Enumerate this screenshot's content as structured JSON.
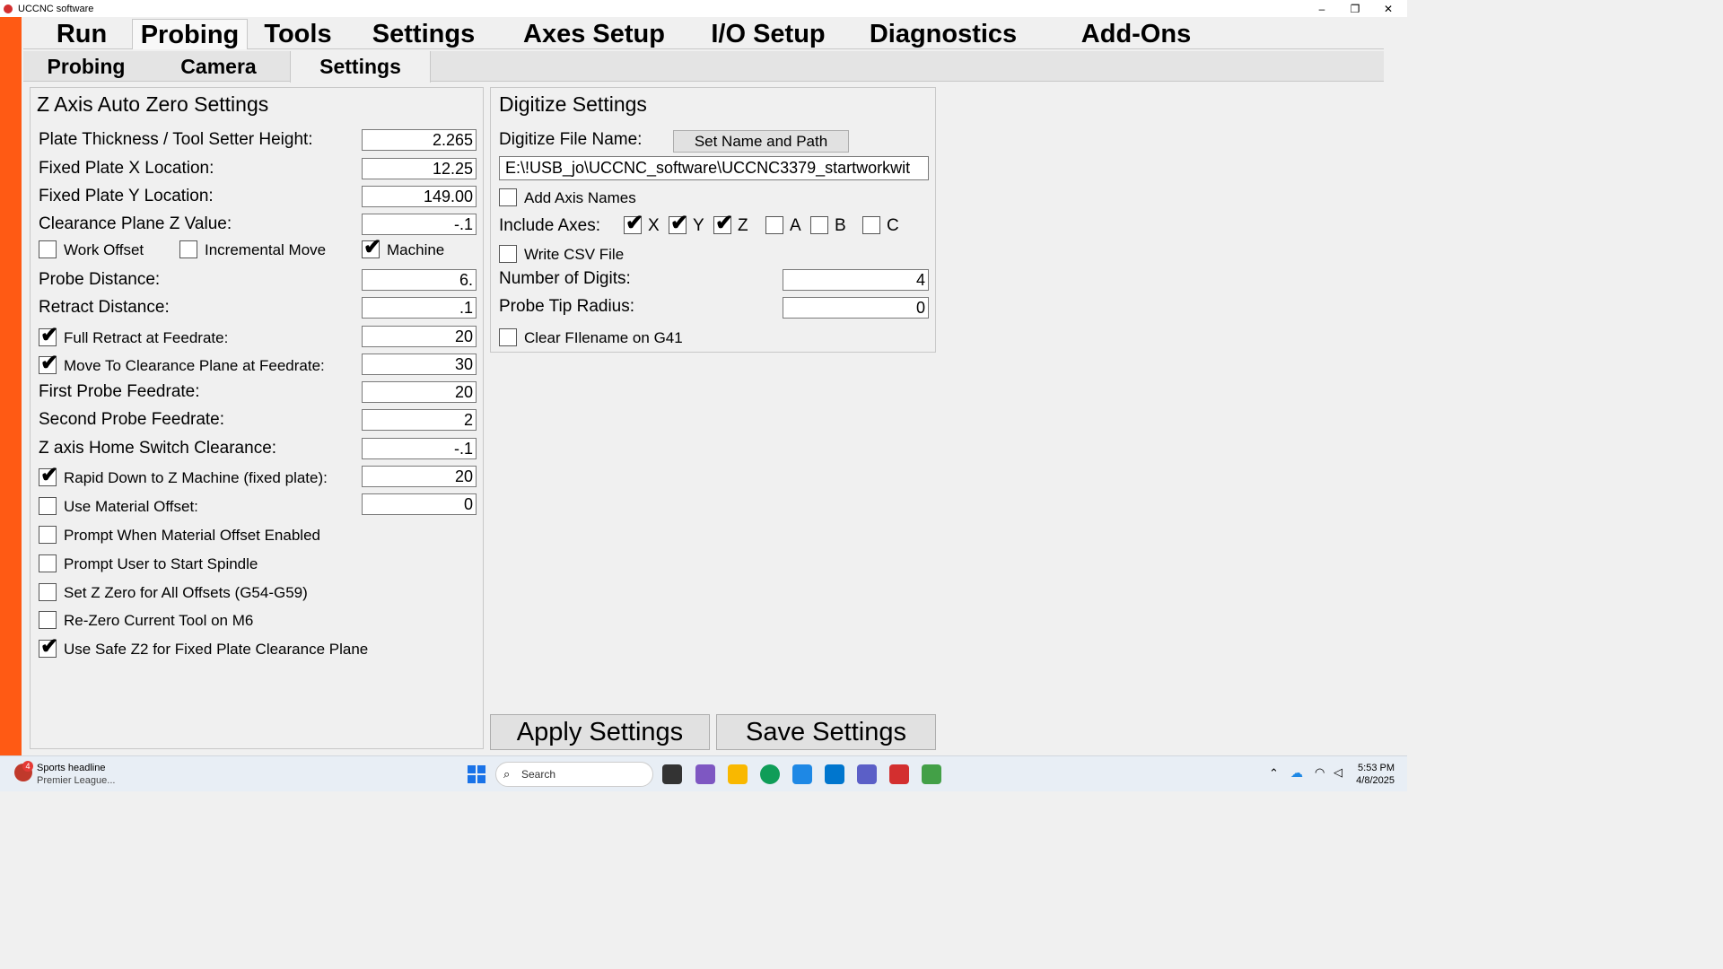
{
  "window": {
    "title": "UCCNC software",
    "minimize": "–",
    "restore": "❐",
    "close": "✕"
  },
  "main_tabs": [
    "Run",
    "Probing",
    "Tools",
    "Settings",
    "Axes Setup",
    "I/O Setup",
    "Diagnostics",
    "Add-Ons"
  ],
  "sub_tabs": [
    "Probing",
    "Camera",
    "Settings"
  ],
  "z_axis": {
    "title": "Z Axis Auto Zero Settings",
    "plate_thickness": {
      "label": "Plate Thickness / Tool Setter Height:",
      "value": "2.265"
    },
    "fixed_x": {
      "label": "Fixed Plate X Location:",
      "value": "12.25"
    },
    "fixed_y": {
      "label": "Fixed Plate Y Location:",
      "value": "149.00"
    },
    "clearance_z": {
      "label": "Clearance Plane Z Value:",
      "value": "-.1"
    },
    "work_offset": {
      "label": "Work Offset",
      "checked": false
    },
    "incremental_move": {
      "label": "Incremental Move",
      "checked": false
    },
    "machine": {
      "label": "Machine",
      "checked": true
    },
    "probe_distance": {
      "label": "Probe Distance:",
      "value": "6."
    },
    "retract_distance": {
      "label": "Retract Distance:",
      "value": ".1"
    },
    "full_retract": {
      "label": "Full Retract at Feedrate:",
      "checked": true,
      "value": "20"
    },
    "move_clearance": {
      "label": "Move To Clearance Plane at Feedrate:",
      "checked": true,
      "value": "30"
    },
    "first_feed": {
      "label": "First Probe Feedrate:",
      "value": "20"
    },
    "second_feed": {
      "label": "Second Probe Feedrate:",
      "value": "2"
    },
    "home_clearance": {
      "label": "Z axis Home Switch Clearance:",
      "value": "-.1"
    },
    "rapid_down": {
      "label": "Rapid Down to Z Machine (fixed plate):",
      "checked": true,
      "value": "20"
    },
    "material_offset": {
      "label": "Use Material Offset:",
      "checked": false,
      "value": "0"
    },
    "prompt_material": {
      "label": "Prompt When Material Offset Enabled",
      "checked": false
    },
    "prompt_spindle": {
      "label": "Prompt User to Start Spindle",
      "checked": false
    },
    "set_z_all": {
      "label": "Set Z Zero for All Offsets (G54-G59)",
      "checked": false
    },
    "rezero_m6": {
      "label": "Re-Zero Current Tool on M6",
      "checked": false
    },
    "safe_z2": {
      "label": "Use Safe Z2 for Fixed Plate Clearance Plane",
      "checked": true
    }
  },
  "digitize": {
    "title": "Digitize Settings",
    "file_label": "Digitize File Name:",
    "set_name_button": "Set Name and Path",
    "file_path": "E:\\!USB_jo\\UCCNC_software\\UCCNC3379_startworkwit",
    "add_axis_names": {
      "label": "Add Axis Names",
      "checked": false
    },
    "include_axes_label": "Include Axes:",
    "axes": [
      {
        "name": "X",
        "checked": true
      },
      {
        "name": "Y",
        "checked": true
      },
      {
        "name": "Z",
        "checked": true
      },
      {
        "name": "A",
        "checked": false
      },
      {
        "name": "B",
        "checked": false
      },
      {
        "name": "C",
        "checked": false
      }
    ],
    "write_csv": {
      "label": "Write CSV File",
      "checked": false
    },
    "num_digits": {
      "label": "Number of Digits:",
      "value": "4"
    },
    "probe_tip": {
      "label": "Probe Tip Radius:",
      "value": "0"
    },
    "clear_filename": {
      "label": "Clear FIlename on G41",
      "checked": false
    }
  },
  "buttons": {
    "apply": "Apply Settings",
    "save": "Save Settings"
  },
  "taskbar": {
    "news_badge": "4",
    "news_title": "Sports headline",
    "news_sub": "Premier League...",
    "search_placeholder": "Search",
    "time": "5:53 PM",
    "date": "4/8/2025"
  },
  "colors": {
    "accent_bar": "#ff5a14",
    "taskbar": "#e8eef5"
  }
}
